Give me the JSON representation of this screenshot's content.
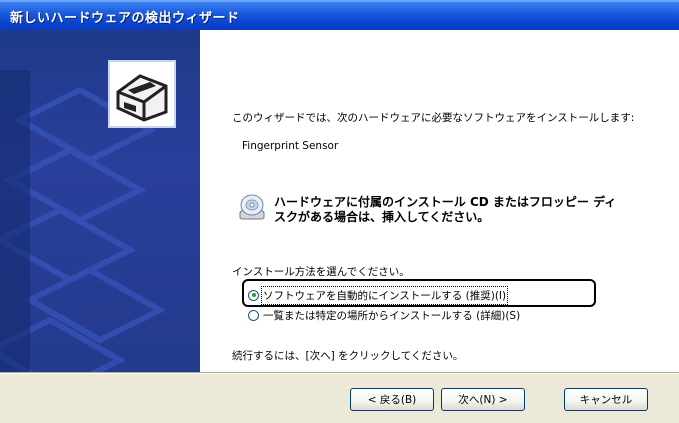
{
  "window": {
    "title": "新しいハードウェアの検出ウィザード"
  },
  "main": {
    "intro": "このウィザードでは、次のハードウェアに必要なソフトウェアをインストールします:",
    "device_name": "Fingerprint Sensor",
    "cd_prompt_line1": "ハードウェアに付属のインストール CD またはフロッピー ディ",
    "cd_prompt_line2": "スクがある場合は、挿入してください。",
    "select_label": "インストール方法を選んでください。",
    "options": [
      {
        "label": "ソフトウェアを自動的にインストールする (推奨)(I)",
        "selected": true
      },
      {
        "label": "一覧または特定の場所からインストールする (詳細)(S)",
        "selected": false
      }
    ],
    "continue_text": "続行するには、[次へ] をクリックしてください。"
  },
  "buttons": {
    "back": "< 戻る(B)",
    "next": "次へ(N) >",
    "cancel": "キャンセル"
  },
  "icons": {
    "wizard": "hardware-wizard-icon",
    "cd": "cd-icon"
  },
  "colors": {
    "titlebar": "#0a46d2",
    "sidebar": "#243a8c",
    "radio_dot": "#21a121"
  }
}
